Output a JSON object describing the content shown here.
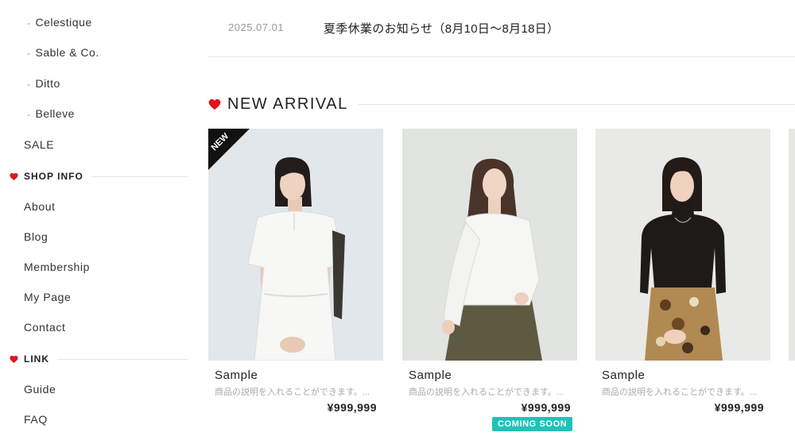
{
  "sidebar": {
    "brands": [
      "Celestique",
      "Sable & Co.",
      "Ditto",
      "Belleve"
    ],
    "dash": "-",
    "sale": "SALE",
    "shop_info": {
      "heading": "SHOP INFO",
      "items": [
        "About",
        "Blog",
        "Membership",
        "My Page",
        "Contact"
      ]
    },
    "link": {
      "heading": "LINK",
      "items": [
        "Guide",
        "FAQ"
      ]
    }
  },
  "news": {
    "date": "2025.07.01",
    "title": "夏季休業のお知らせ（8月10日〜8月18日）"
  },
  "new_arrival": {
    "heading": "NEW ARRIVAL",
    "products": [
      {
        "name": "Sample",
        "description": "商品の説明を入れることができます。...",
        "price": "¥999,999",
        "ribbon": "NEW"
      },
      {
        "name": "Sample",
        "description": "商品の説明を入れることができます。...",
        "price": "¥999,999",
        "badge": "COMING SOON"
      },
      {
        "name": "Sample",
        "description": "商品の説明を入れることができます。...",
        "price": "¥999,999"
      }
    ]
  },
  "colors": {
    "accent_heart": "#e0141e",
    "coming_soon": "#1ec3b8"
  }
}
